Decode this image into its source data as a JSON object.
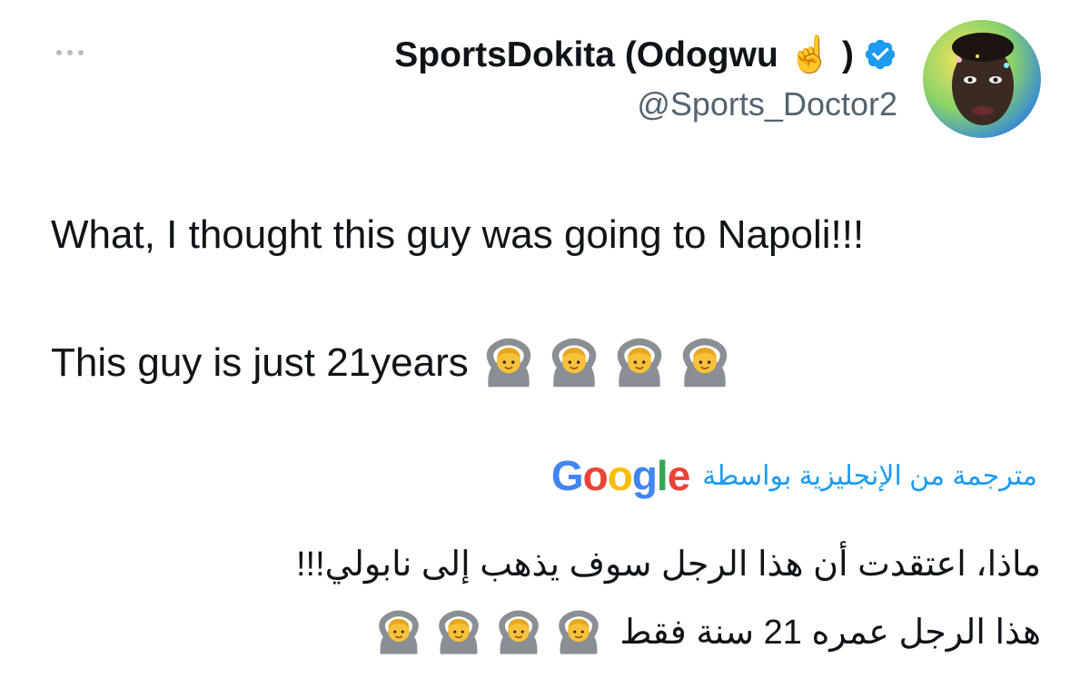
{
  "author": {
    "display_name": "SportsDokita (Odogwu ☝️ )",
    "handle": "@Sports_Doctor2",
    "verified": true,
    "avatar_icon": "profile-photo"
  },
  "tweet": {
    "line1": "What, I thought this guy was going to Napoli!!!",
    "line2": "This guy is just 21years",
    "emoji_icon": "person-gesturing-ok-emoji",
    "emoji_count": 4
  },
  "translation": {
    "label": "مترجمة من الإنجليزية بواسطة",
    "provider": "Google",
    "line1": "ماذا، اعتقدت أن هذا الرجل سوف يذهب إلى نابولي!!!",
    "line2": "هذا الرجل عمره 21 سنة فقط"
  },
  "colors": {
    "accent": "#1d9bf0",
    "secondary_text": "#536471",
    "google_blue": "#4285F4",
    "google_red": "#EA4335",
    "google_yellow": "#FBBC05",
    "google_green": "#34A853"
  }
}
